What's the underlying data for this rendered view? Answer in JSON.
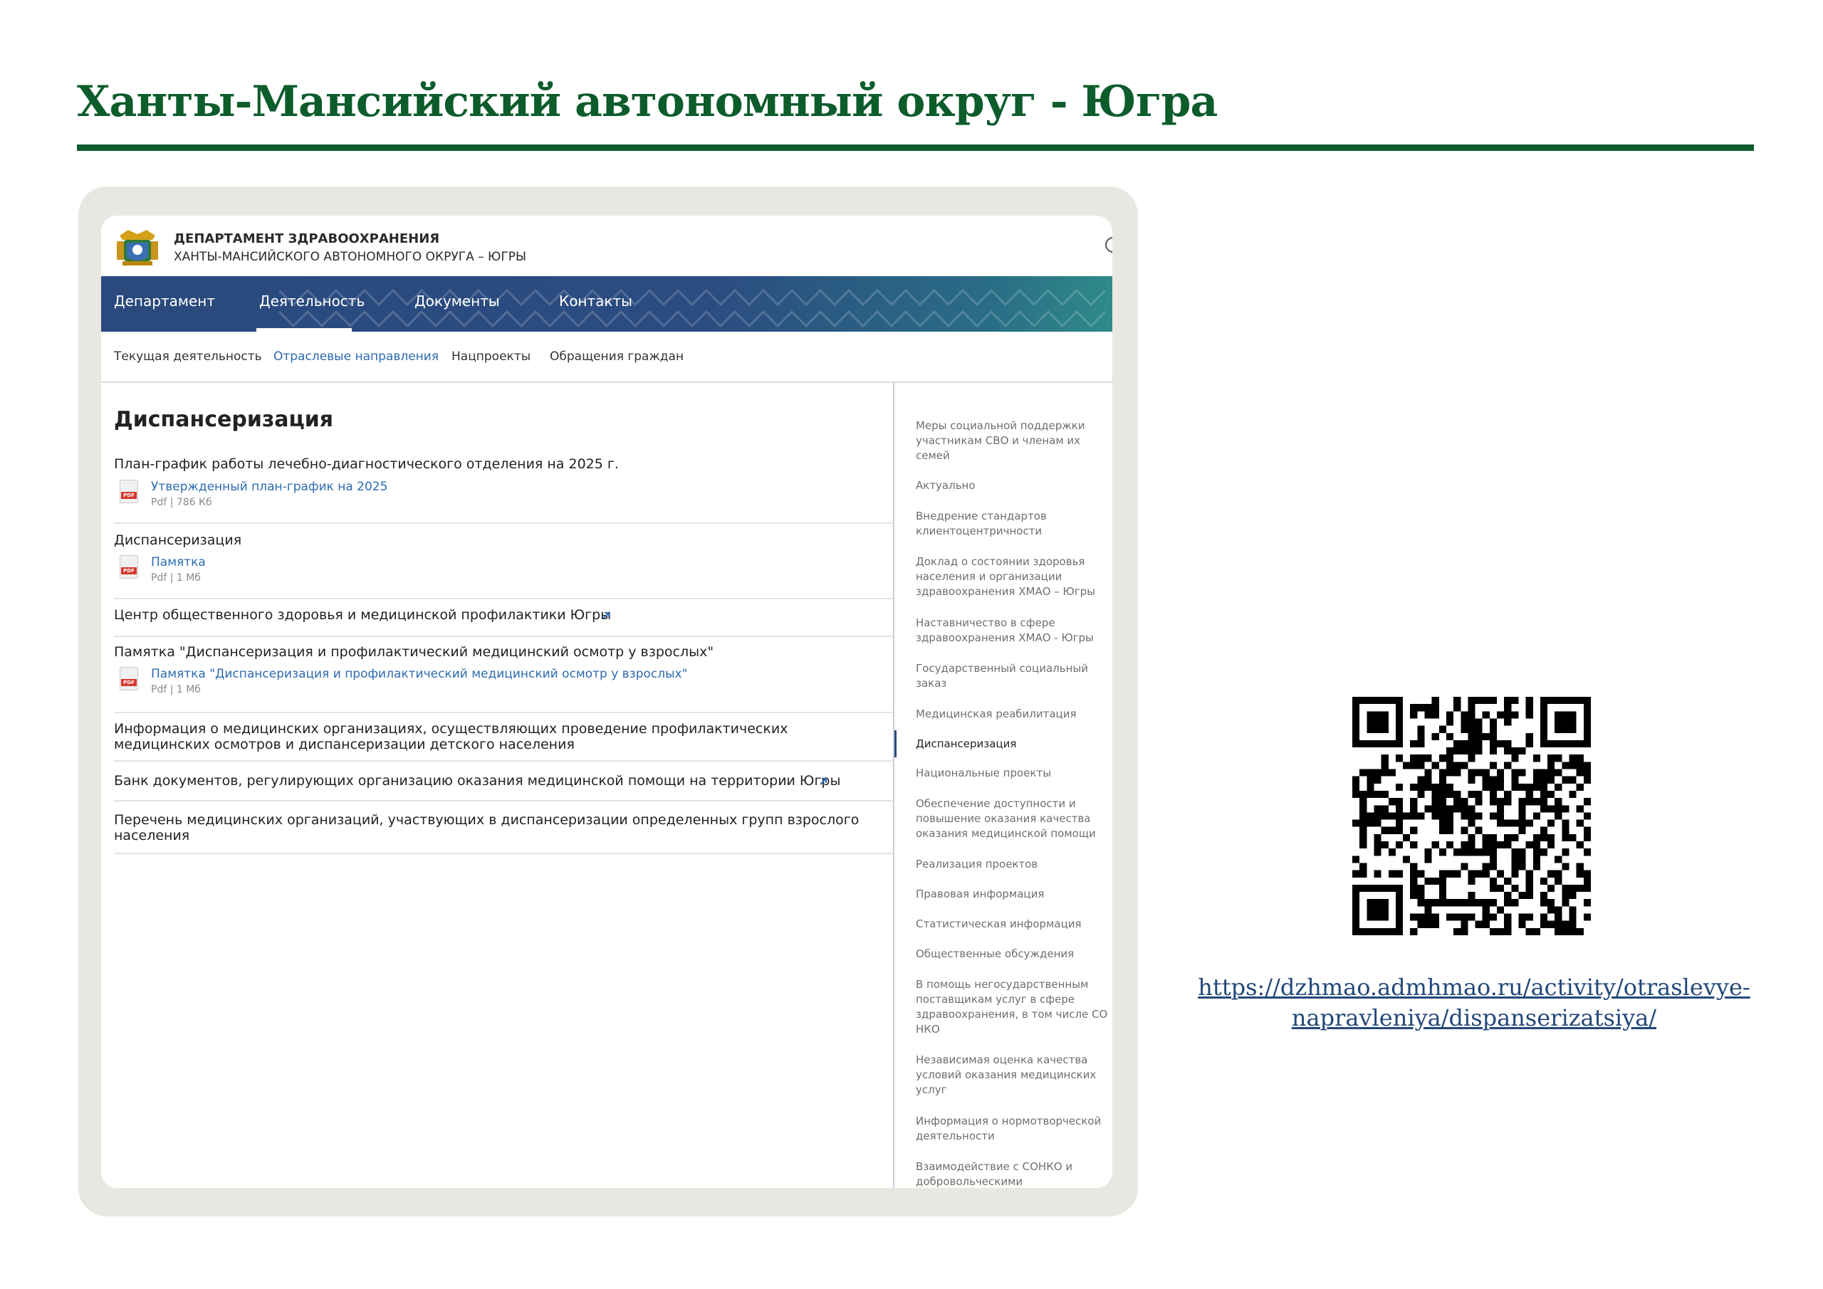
{
  "slide": {
    "title": "Ханты-Мансийский автономный округ - Югра",
    "qr_link": "https://dzhmao.admhmao.ru/activity/otraslevye-napravleniya/dispanserizatsiya/"
  },
  "site": {
    "dept_line1": "ДЕПАРТАМЕНТ ЗДРАВООХРАНЕНИЯ",
    "dept_line2": "ХАНТЫ-МАНСИЙСКОГО АВТОНОМНОГО ОКРУГА – ЮГРЫ",
    "nav": [
      "Департамент",
      "Деятельность",
      "Документы",
      "Контакты"
    ],
    "subnav": [
      "Текущая деятельность",
      "Отраслевые направления",
      "Нацпроекты",
      "Обращения граждан"
    ]
  },
  "content": {
    "heading": "Диспансеризация",
    "sections": [
      {
        "title": "План-график работы лечебно-диагностического отделения на 2025 г.",
        "file_label": "Утвержденный план-график на 2025",
        "file_meta": "Pdf | 786 Кб"
      },
      {
        "title": "Диспансеризация",
        "file_label": "Памятка",
        "file_meta": "Pdf | 1 Мб"
      },
      {
        "title": "Центр общественного здоровья и медицинской профилактики Югры"
      },
      {
        "title": "Памятка \"Диспансеризация и профилактический медицинский осмотр у взрослых\"",
        "file_label": "Памятка \"Диспансеризация и профилактический медицинский осмотр у взрослых\"",
        "file_meta": "Pdf | 1 Мб"
      },
      {
        "title": "Информация о медицинских организациях, осуществляющих проведение профилактических медицинских осмотров и диспансеризации детского населения"
      },
      {
        "title": "Банк документов, регулирующих организацию оказания медицинской помощи на территории Югры"
      },
      {
        "title": "Перечень медицинских организаций, участвующих в диспансеризации определенных групп взрослого населения"
      }
    ]
  },
  "sidebar": {
    "items": [
      "Меры социальной поддержки участникам СВО и членам их семей",
      "Актуально",
      "Внедрение стандартов клиентоцентричности",
      "Доклад о состоянии здоровья населения и организации здравоохранения ХМАО – Югры",
      "Наставничество в сфере здравоохранения ХМАО - Югры",
      "Государственный социальный заказ",
      "Медицинская реабилитация",
      "Диспансеризация",
      "Национальные проекты",
      "Обеспечение доступности и повышение оказания качества оказания медицинской помощи",
      "Реализация проектов",
      "Правовая информация",
      "Статистическая информация",
      "Общественные обсуждения",
      "В помощь негосударственным поставщикам услуг в сфере здравоохранения, в том числе СО НКО",
      "Независимая оценка качества условий оказания медицинских услуг",
      "Информация о нормотворческой деятельности",
      "Взаимодействие с СОНКО и добровольческими"
    ],
    "active_item": "Диспансеризация"
  },
  "colors": {
    "title_green": "#0d5c2c",
    "nav_blue": "#2a4a7e",
    "link_blue": "#2d6bb0",
    "url_blue": "#23487a"
  }
}
